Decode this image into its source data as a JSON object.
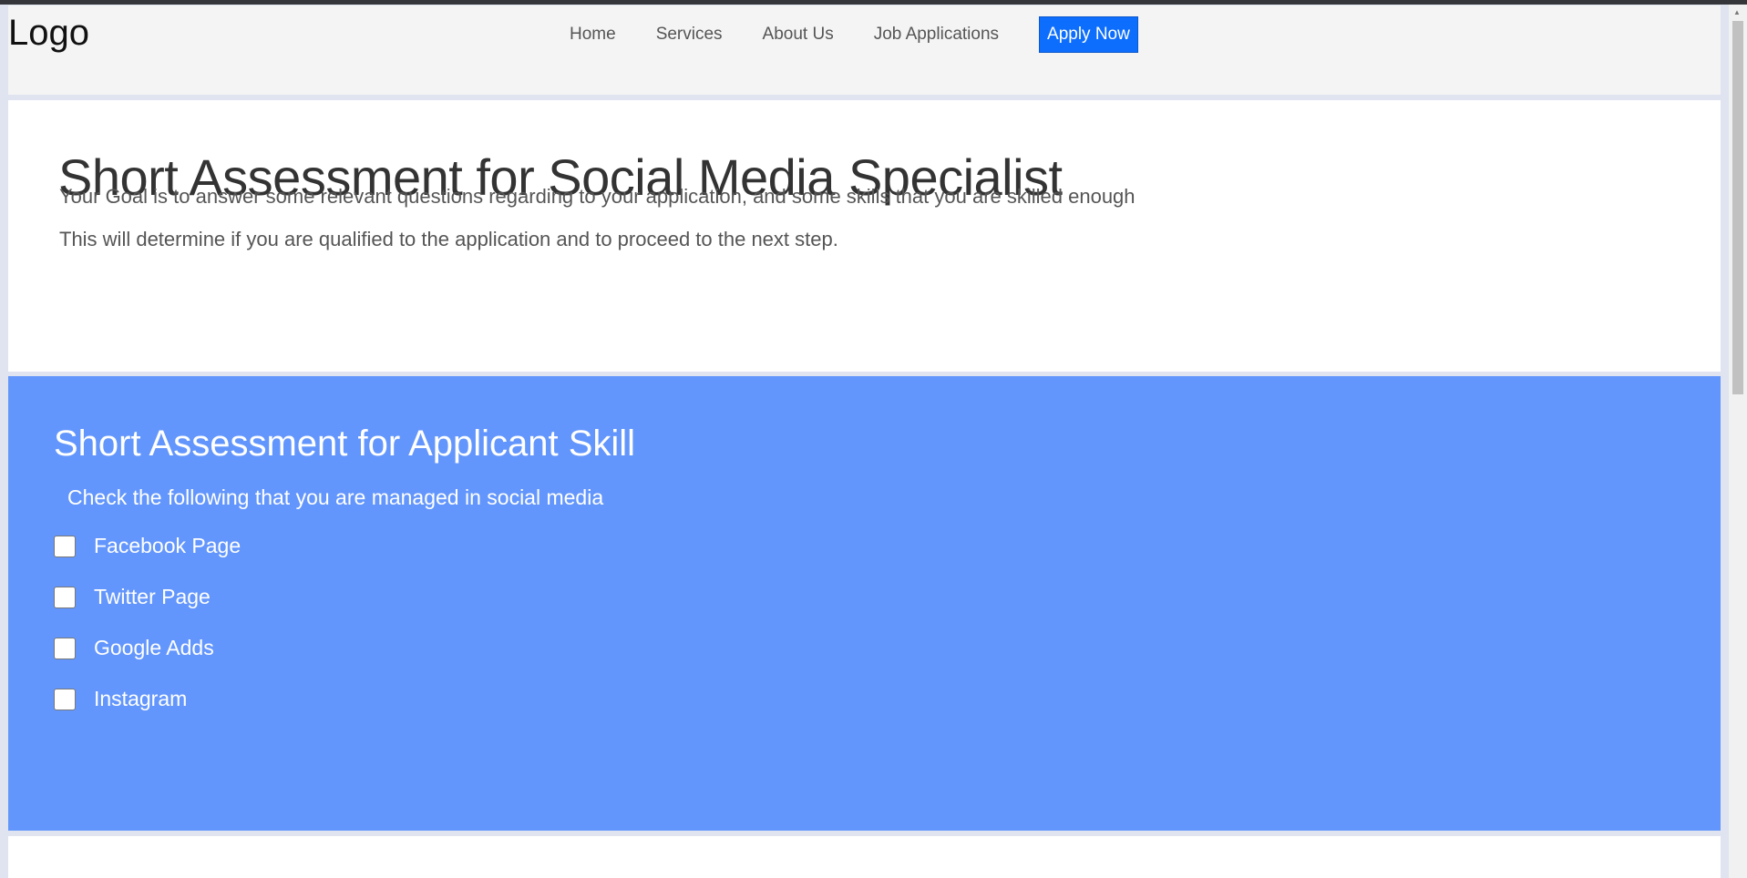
{
  "header": {
    "logo": "Logo",
    "nav": [
      "Home",
      "Services",
      "About Us",
      "Job Applications"
    ],
    "cta": "Apply Now"
  },
  "intro": {
    "title": "Short Assessment for Social Media Specialist",
    "line1": "Your Goal is to answer some relevant questions regarding to your application, and some skills that you are skilled enough",
    "line2": "This will determine if you are qualified to the application and to proceed to the next step."
  },
  "skills": {
    "title": "Short Assessment for Applicant Skill",
    "hint": "Check the following that you are managed in social media",
    "options": [
      {
        "label": "Facebook Page",
        "checked": false
      },
      {
        "label": "Twitter Page",
        "checked": false
      },
      {
        "label": "Google Adds",
        "checked": false
      },
      {
        "label": "Instagram",
        "checked": false
      }
    ]
  },
  "colors": {
    "accent": "#0d6efd",
    "section": "#6396fc"
  }
}
